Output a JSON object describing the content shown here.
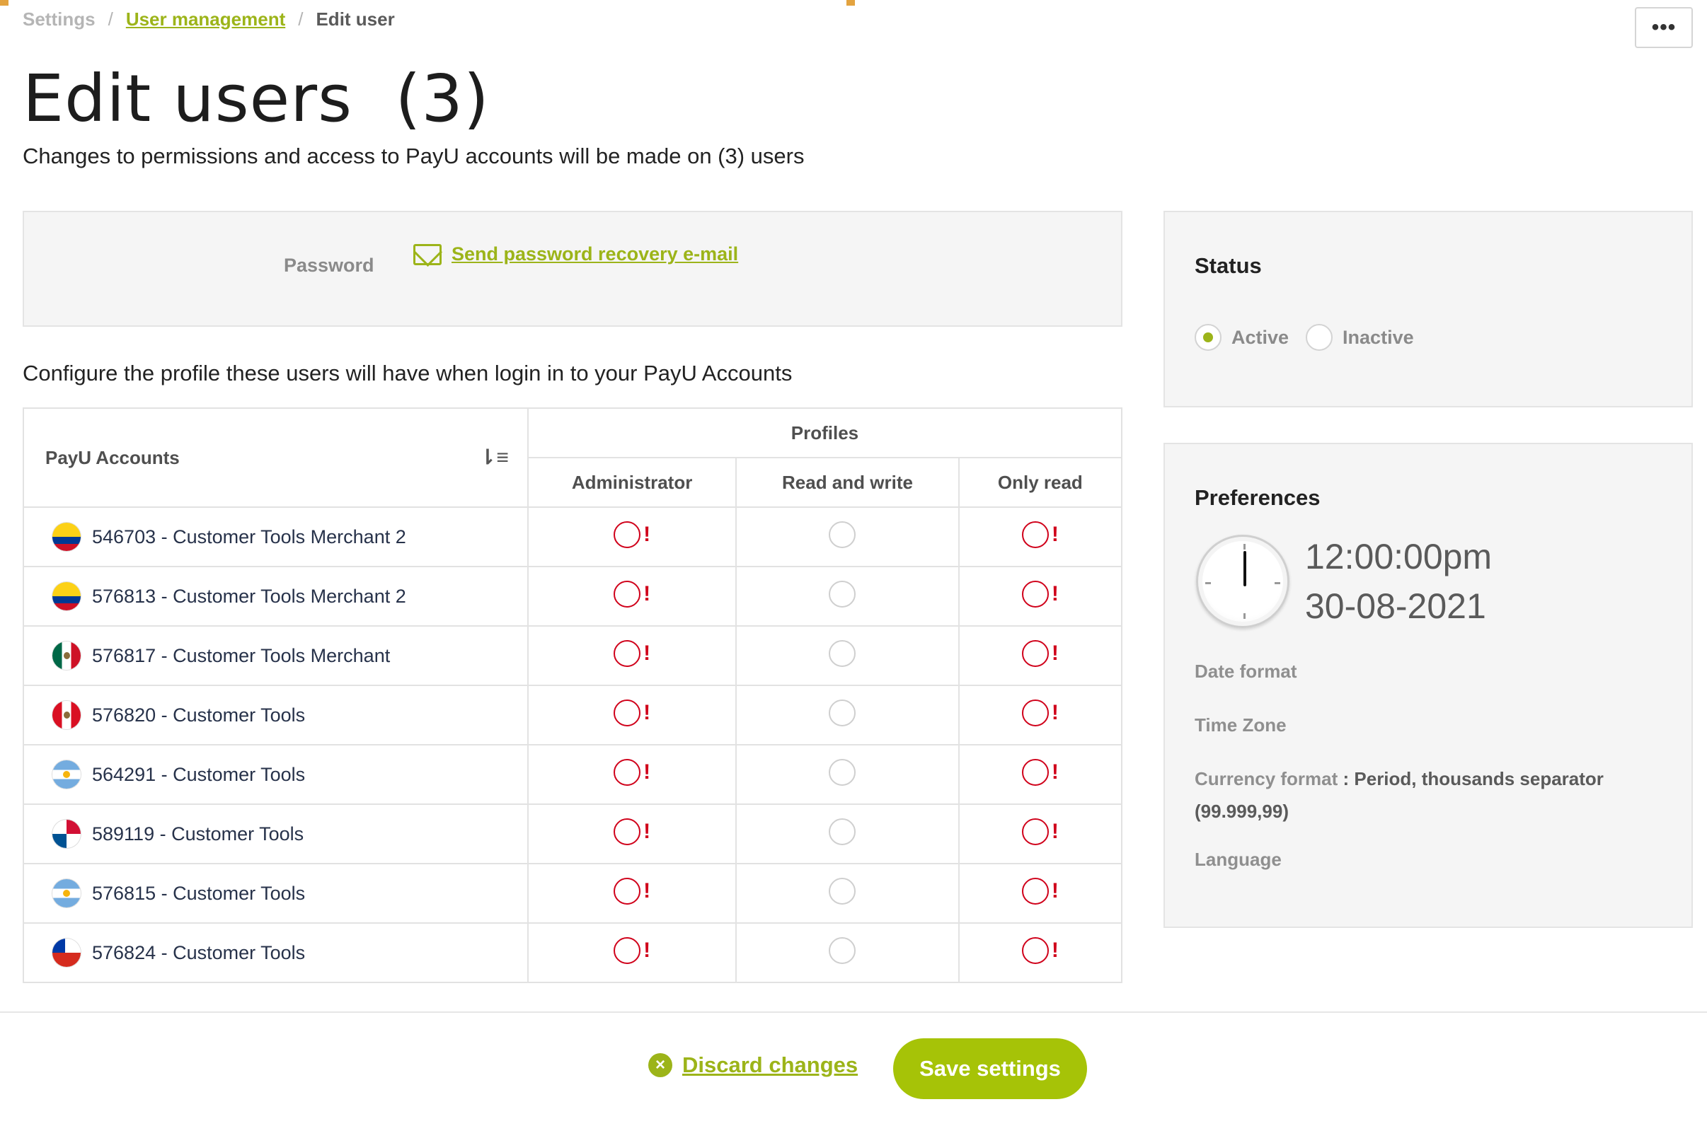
{
  "breadcrumb": {
    "root": "Settings",
    "parent": "User management",
    "current": "Edit user",
    "separator": "/"
  },
  "header": {
    "more_label": "•••",
    "title": "Edit users  (3)",
    "subtitle": "Changes to permissions and access to PayU accounts will be made on (3) users"
  },
  "password": {
    "label": "Password",
    "link_text": "Send password recovery e-mail",
    "icon": "mail-icon"
  },
  "config_text": "Configure the profile these users will have when login in to your PayU Accounts",
  "table": {
    "accounts_header": "PayU Accounts",
    "profiles_header": "Profiles",
    "columns": [
      "Administrator",
      "Read and write",
      "Only read"
    ],
    "rows": [
      {
        "label": "546703 - Customer Tools Merchant 2",
        "flag": "co"
      },
      {
        "label": "576813 - Customer Tools Merchant 2",
        "flag": "co"
      },
      {
        "label": "576817 - Customer Tools Merchant",
        "flag": "mx"
      },
      {
        "label": "576820 - Customer Tools",
        "flag": "pe"
      },
      {
        "label": "564291 - Customer Tools",
        "flag": "ar"
      },
      {
        "label": "589119 - Customer Tools",
        "flag": "pa"
      },
      {
        "label": "576815 - Customer Tools",
        "flag": "ar"
      },
      {
        "label": "576824 - Customer Tools",
        "flag": "cl"
      }
    ],
    "warning_mark": "!"
  },
  "status": {
    "title": "Status",
    "options": [
      {
        "label": "Active",
        "checked": true
      },
      {
        "label": "Inactive",
        "checked": false
      }
    ]
  },
  "preferences": {
    "title": "Preferences",
    "time": "12:00:00pm",
    "date": "30-08-2021",
    "date_format_label": "Date format",
    "time_zone_label": "Time Zone",
    "currency_label": "Currency format",
    "currency_value": " : Period, thousands separator",
    "currency_value_2": "(99.999,99)",
    "language_label": "Language"
  },
  "footer": {
    "discard_label": "Discard changes",
    "discard_icon": "×",
    "save_label": "Save settings"
  },
  "colors": {
    "accent": "#9cb419",
    "button": "#a6c307",
    "error": "#d0021b"
  }
}
